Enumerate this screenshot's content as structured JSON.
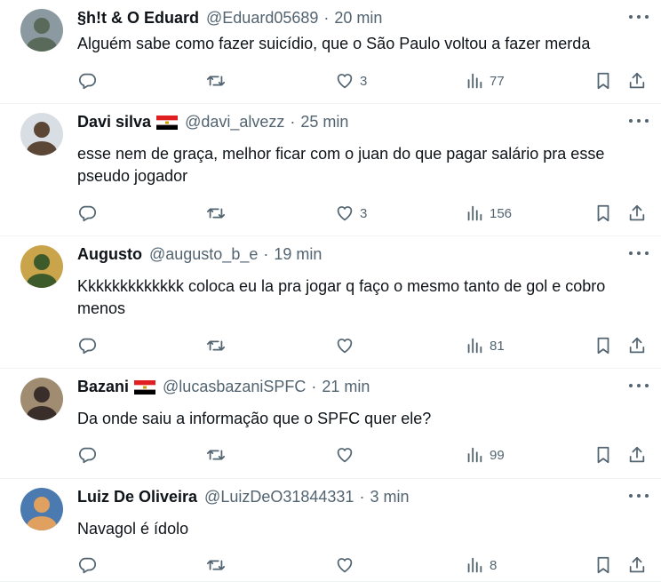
{
  "tweets": [
    {
      "name": "§h!t & O Eduard",
      "handle": "@Eduard05689",
      "time": "20 min",
      "has_flag": false,
      "text": "Alguém sabe como fazer suicídio, que o São Paulo voltou a fazer merda",
      "replies": "",
      "retweets": "",
      "likes": "3",
      "views": "77",
      "avatar_colors": [
        "#8a9aa0",
        "#5a6a5a"
      ]
    },
    {
      "name": "Davi silva",
      "handle": "@davi_alvezz",
      "time": "25 min",
      "has_flag": true,
      "text": "esse nem de graça, melhor ficar com o juan do que pagar salário pra esse pseudo jogador",
      "replies": "",
      "retweets": "",
      "likes": "3",
      "views": "156",
      "avatar_colors": [
        "#d8dee4",
        "#5c4636"
      ]
    },
    {
      "name": "Augusto",
      "handle": "@augusto_b_e",
      "time": "19 min",
      "has_flag": false,
      "text": "Kkkkkkkkkkkkk coloca eu la pra jogar q faço o mesmo tanto de gol e cobro menos",
      "replies": "",
      "retweets": "",
      "likes": "",
      "views": "81",
      "avatar_colors": [
        "#c9a44a",
        "#3d5a2a"
      ]
    },
    {
      "name": "Bazani",
      "handle": "@lucasbazaniSPFC",
      "time": "21 min",
      "has_flag": true,
      "text": "Da onde saiu a informação que o SPFC quer ele?",
      "replies": "",
      "retweets": "",
      "likes": "",
      "views": "99",
      "avatar_colors": [
        "#a08c70",
        "#3a2e2a"
      ]
    },
    {
      "name": "Luiz De Oliveira",
      "handle": "@LuizDeO31844331",
      "time": "3 min",
      "has_flag": false,
      "text": "Navagol é ídolo",
      "replies": "",
      "retweets": "",
      "likes": "",
      "views": "8",
      "avatar_colors": [
        "#4a7ab0",
        "#e0a060"
      ]
    }
  ],
  "colors": {
    "text": "#0f1419",
    "secondary": "#536471",
    "divider": "#eff3f4",
    "flag_red": "#e02020",
    "flag_black": "#000000"
  },
  "icons": [
    "reply-icon",
    "retweet-icon",
    "like-icon",
    "views-icon",
    "bookmark-icon",
    "share-icon",
    "more-icon"
  ]
}
